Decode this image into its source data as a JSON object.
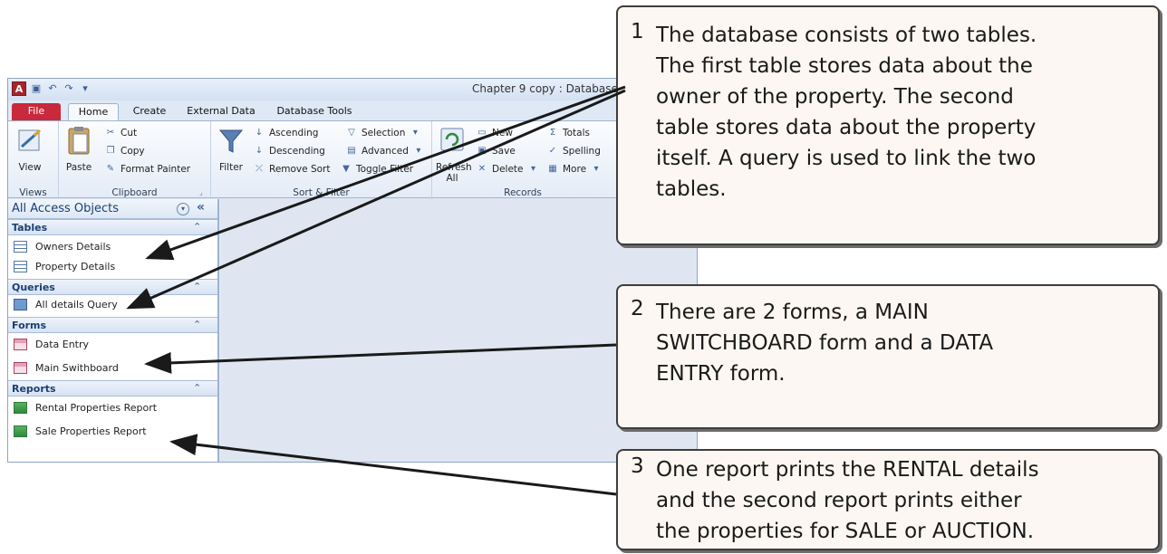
{
  "window": {
    "title": "Chapter 9 copy : Database (",
    "app_icon_letter": "A"
  },
  "tabs": [
    "File",
    "Home",
    "Create",
    "External Data",
    "Database Tools"
  ],
  "ribbon": {
    "views": {
      "view_label": "View",
      "group_label": "Views"
    },
    "clipboard": {
      "paste_label": "Paste",
      "cut": "Cut",
      "copy": "Copy",
      "format_painter": "Format Painter",
      "group_label": "Clipboard"
    },
    "sort_filter": {
      "filter_label": "Filter",
      "ascending": "Ascending",
      "descending": "Descending",
      "remove_sort": "Remove Sort",
      "selection": "Selection",
      "advanced": "Advanced",
      "toggle_filter": "Toggle Filter",
      "group_label": "Sort & Filter"
    },
    "records": {
      "refresh_label": "Refresh",
      "refresh_sub": "All",
      "new": "New",
      "save": "Save",
      "delete": "Delete",
      "totals": "Totals",
      "spelling": "Spelling",
      "more": "More",
      "group_label": "Records"
    }
  },
  "nav": {
    "title": "All Access Objects",
    "sections": [
      {
        "label": "Tables",
        "items": [
          "Owners Details",
          "Property Details"
        ]
      },
      {
        "label": "Queries",
        "items": [
          "All details Query"
        ]
      },
      {
        "label": "Forms",
        "items": [
          "Data Entry",
          "Main Swithboard"
        ]
      },
      {
        "label": "Reports",
        "items": [
          "Rental Properties Report",
          "Sale Properties Report"
        ]
      }
    ]
  },
  "callouts": [
    {
      "number": "1",
      "lines": [
        "The database consists of two tables.",
        "The first table stores data about the",
        "owner of the property.  The second",
        "table stores data about the property",
        "itself.  A query is used to link the two",
        "tables."
      ]
    },
    {
      "number": "2",
      "lines": [
        "There are 2 forms, a MAIN",
        "SWITCHBOARD form and a DATA",
        "ENTRY form."
      ]
    },
    {
      "number": "3",
      "lines": [
        "One report prints the RENTAL details",
        "and the second report prints either",
        "the properties for SALE or AUCTION."
      ]
    }
  ]
}
